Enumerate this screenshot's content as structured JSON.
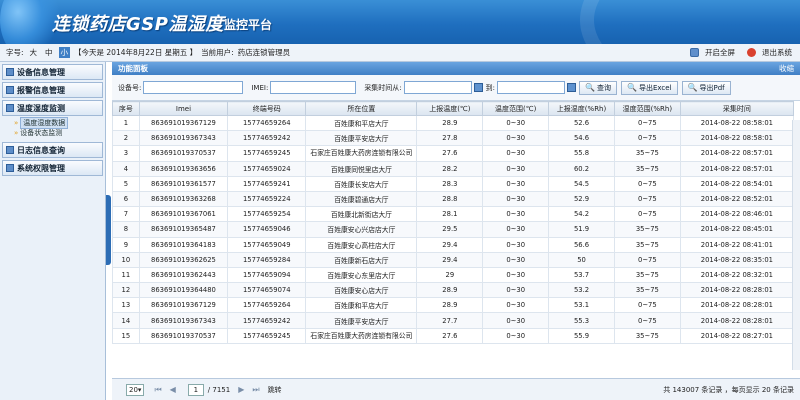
{
  "header": {
    "title": "连锁药店GSP温湿度",
    "subtitle": "监控平台"
  },
  "infobar": {
    "font_label": "字号:",
    "font_sizes": [
      "大",
      "中",
      "小"
    ],
    "date_text": "【今天是 2014年8月22日 星期五 】",
    "user_label": "当前用户:",
    "user_name": "药店连锁管理员",
    "fullscreen_label": "开启全屏",
    "logout_label": "退出系统"
  },
  "sidebar": {
    "items": [
      {
        "label": "设备信息管理"
      },
      {
        "label": "报警信息管理"
      },
      {
        "label": "温度湿度监测"
      },
      {
        "label": "日志信息查询"
      },
      {
        "label": "系统权限管理"
      }
    ],
    "sub_items": [
      {
        "label": "温度湿度数据"
      },
      {
        "label": "设备状态监测"
      }
    ]
  },
  "panel": {
    "title": "功能面板",
    "collapse_label": "收缩"
  },
  "search": {
    "device_label": "设备号:",
    "imei_label": "IMEI:",
    "time_from_label": "采集时间从:",
    "time_to_label": "到:",
    "query_label": "查询",
    "export_excel_label": "导出Excel",
    "export_pdf_label": "导出Pdf"
  },
  "table": {
    "headers": [
      "序号",
      "Imei",
      "终端号码",
      "所在位置",
      "上报温度(℃)",
      "温度范围(℃)",
      "上报湿度(%Rh)",
      "湿度范围(%Rh)",
      "采集时间"
    ],
    "rows": [
      [
        "1",
        "863691019367129",
        "15774659264",
        "百姓康和平店大厅",
        "28.9",
        "0~30",
        "52.6",
        "0~75",
        "2014-08-22 08:58:01"
      ],
      [
        "2",
        "863691019367343",
        "15774659242",
        "百姓康平安店大厅",
        "27.8",
        "0~30",
        "54.6",
        "0~75",
        "2014-08-22 08:58:01"
      ],
      [
        "3",
        "863691019370537",
        "15774659245",
        "石家庄百姓康大药房连锁有限公司",
        "27.6",
        "0~30",
        "55.8",
        "35~75",
        "2014-08-22 08:57:01"
      ],
      [
        "4",
        "863691019363656",
        "15774659024",
        "百姓康同悦里店大厅",
        "28.2",
        "0~30",
        "60.2",
        "35~75",
        "2014-08-22 08:57:01"
      ],
      [
        "5",
        "863691019361577",
        "15774659241",
        "百姓康长安店大厅",
        "28.3",
        "0~30",
        "54.5",
        "0~75",
        "2014-08-22 08:54:01"
      ],
      [
        "6",
        "863691019363268",
        "15774659224",
        "百姓康碧通店大厅",
        "28.8",
        "0~30",
        "52.9",
        "0~75",
        "2014-08-22 08:52:01"
      ],
      [
        "7",
        "863691019367061",
        "15774659254",
        "百姓康北新街店大厅",
        "28.1",
        "0~30",
        "54.2",
        "0~75",
        "2014-08-22 08:46:01"
      ],
      [
        "8",
        "863691019365487",
        "15774659046",
        "百姓康安心兴店店大厅",
        "29.5",
        "0~30",
        "51.9",
        "35~75",
        "2014-08-22 08:45:01"
      ],
      [
        "9",
        "863691019364183",
        "15774659049",
        "百姓康安心高柱店大厅",
        "29.4",
        "0~30",
        "56.6",
        "35~75",
        "2014-08-22 08:41:01"
      ],
      [
        "10",
        "863691019362625",
        "15774659284",
        "百姓康新石店大厅",
        "29.4",
        "0~30",
        "50",
        "0~75",
        "2014-08-22 08:35:01"
      ],
      [
        "11",
        "863691019362443",
        "15774659094",
        "百姓康安心东里店大厅",
        "29",
        "0~30",
        "53.7",
        "35~75",
        "2014-08-22 08:32:01"
      ],
      [
        "12",
        "863691019364480",
        "15774659074",
        "百姓康安心店大厅",
        "28.9",
        "0~30",
        "53.2",
        "35~75",
        "2014-08-22 08:28:01"
      ],
      [
        "13",
        "863691019367129",
        "15774659264",
        "百姓康和平店大厅",
        "28.9",
        "0~30",
        "53.1",
        "0~75",
        "2014-08-22 08:28:01"
      ],
      [
        "14",
        "863691019367343",
        "15774659242",
        "百姓康平安店大厅",
        "27.7",
        "0~30",
        "55.3",
        "0~75",
        "2014-08-22 08:28:01"
      ],
      [
        "15",
        "863691019370537",
        "15774659245",
        "石家庄百姓康大药房连锁有限公司",
        "27.6",
        "0~30",
        "55.9",
        "35~75",
        "2014-08-22 08:27:01"
      ]
    ]
  },
  "pager": {
    "page_size": "20",
    "current_page": "1",
    "total_pages_text": "/ 7151",
    "go_label": "跳转",
    "summary": "共 143007 条记录 ，每页显示 20 条记录"
  }
}
